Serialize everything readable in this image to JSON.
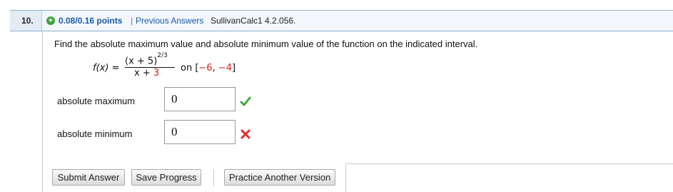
{
  "header": {
    "number": "10.",
    "points": "0.08/0.16 points",
    "separator": "|",
    "previous_answers": "Previous Answers",
    "problem_id": "SullivanCalc1 4.2.056."
  },
  "question": {
    "prompt": "Find the absolute maximum value and absolute minimum value of the function on the indicated interval.",
    "function": {
      "lhs": "f(x)",
      "equals": "=",
      "numerator_base": "(x + 5)",
      "numerator_exponent": "2/3",
      "denominator_var": "x + ",
      "denominator_const": "3",
      "interval_prefix": "on [",
      "interval_a": "−6",
      "interval_comma": ", ",
      "interval_b": "−4",
      "interval_suffix": "]"
    }
  },
  "answers": [
    {
      "label": "absolute maximum",
      "value": "0",
      "status": "correct"
    },
    {
      "label": "absolute minimum",
      "value": "0",
      "status": "incorrect"
    }
  ],
  "buttons": {
    "submit": "Submit Answer",
    "save": "Save Progress",
    "practice": "Practice Another Version"
  },
  "colors": {
    "header_bg": "#b4cde3",
    "link": "#1a5aa6",
    "correct": "#3fa83f",
    "incorrect": "#e03030",
    "red_value": "#d62020"
  }
}
